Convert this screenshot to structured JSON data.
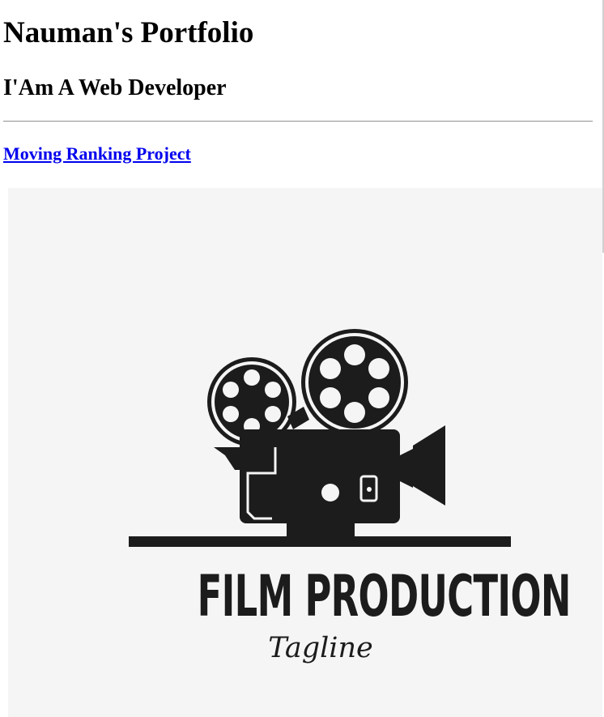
{
  "page": {
    "title": "Nauman's Portfolio",
    "subtitle": "I'Am A Web Developer"
  },
  "projects": [
    {
      "link_text": "Moving Ranking Project",
      "image": {
        "icon": "film-camera-icon",
        "logo_title": "FILM PRODUCTION",
        "logo_tagline": "Tagline"
      }
    }
  ],
  "colors": {
    "link": "#0000ee",
    "image_background": "#f5f5f5",
    "logo_ink": "#1c1c1c",
    "divider": "#9a9a9a"
  }
}
